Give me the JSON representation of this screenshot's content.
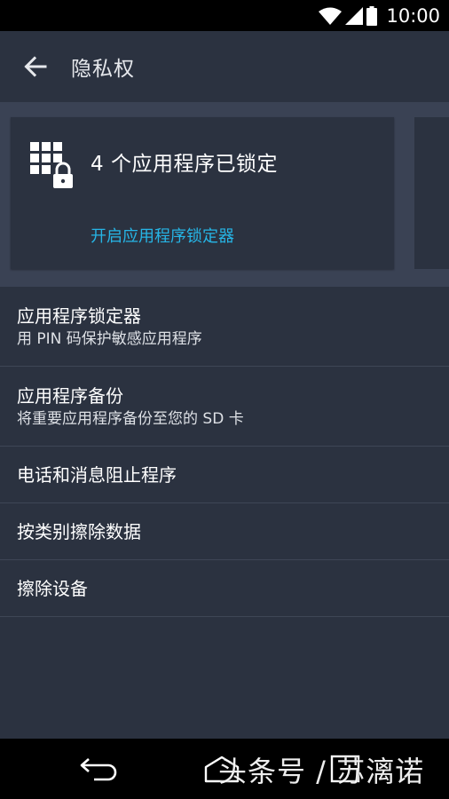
{
  "status_bar": {
    "time": "10:00",
    "icons": [
      "wifi-icon",
      "signal-icon",
      "battery-icon"
    ]
  },
  "app_bar": {
    "title": "隐私权",
    "back_icon": "arrow-left-icon"
  },
  "card": {
    "icon": "app-grid-lock-icon",
    "title": "4 个应用程序已锁定",
    "action": "开启应用程序锁定器",
    "accent_color": "#26b5e6"
  },
  "items": [
    {
      "title": "应用程序锁定器",
      "subtitle": "用 PIN 码保护敏感应用程序"
    },
    {
      "title": "应用程序备份",
      "subtitle": "将重要应用程序备份至您的 SD 卡"
    },
    {
      "title": "电话和消息阻止程序"
    },
    {
      "title": "按类别擦除数据"
    },
    {
      "title": "擦除设备"
    }
  ],
  "nav_bar": {
    "icons": [
      "nav-back-icon",
      "nav-home-icon",
      "nav-recents-icon"
    ]
  },
  "watermark": "头条号 / 苏漓诺",
  "colors": {
    "background": "#2b3240",
    "card_strip": "#3a4254",
    "divider": "#3e4656",
    "accent": "#26b5e6"
  }
}
